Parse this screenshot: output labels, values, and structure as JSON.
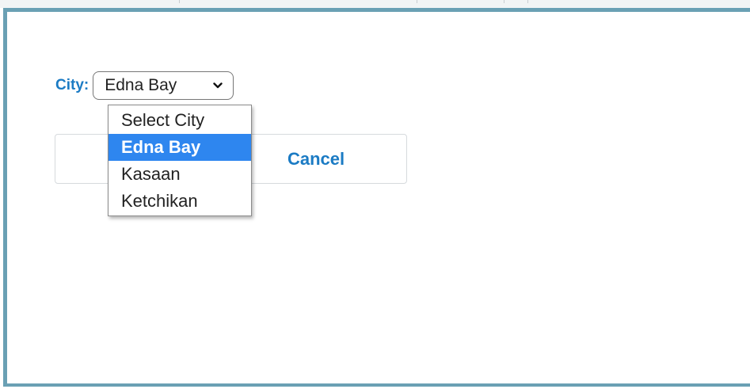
{
  "form": {
    "city_label": "City:",
    "city_select": {
      "value": "Edna Bay",
      "options": [
        "Select City",
        "Edna Bay",
        "Kasaan",
        "Ketchikan"
      ],
      "selected_index": 1
    },
    "save_label": "",
    "cancel_label": "Cancel"
  },
  "colors": {
    "accent": "#1b7bc4",
    "modal_border": "#6aa0b4",
    "option_highlight": "#2e86ef"
  }
}
